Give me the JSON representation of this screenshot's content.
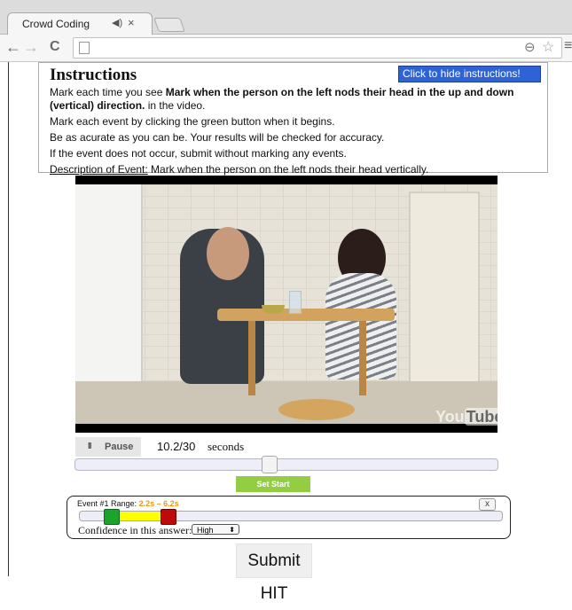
{
  "browser": {
    "tab_title": "Crowd Coding",
    "tab_audio_icon": "speaker-icon",
    "tab_close_icon": "close-icon",
    "back_icon": "←",
    "forward_icon": "→",
    "reload_icon": "C",
    "zoom_icon": "⊖",
    "star_icon": "☆",
    "menu_icon": "≡"
  },
  "instructions": {
    "title": "Instructions",
    "hide_button": "Click to hide instructions!",
    "line1_prefix": "Mark each time you see ",
    "line1_bold": "Mark when the person on the left nods their head in the up and down (vertical) direction.",
    "line1_suffix": " in the video.",
    "line2": "Mark each event by clicking the green button when it begins.",
    "line3": "Be as acurate as you can be. Your results will be checked for accuracy.",
    "line4": "If the event does not occur, submit without marking any events.",
    "desc_label": "Description of Event:",
    "desc_text": " Mark when the person on the left nods their head vertically."
  },
  "video": {
    "logo_you": "You",
    "logo_tube": "Tube"
  },
  "controls": {
    "pause_icon": "II",
    "pause_label": "Pause",
    "time": "10.2/30",
    "seconds_label": "seconds",
    "progress_fraction": 0.34,
    "set_start_label": "Set Start"
  },
  "event": {
    "label_prefix": "Event #1 Range: ",
    "range": "2.2s – 6.2s",
    "close": "x",
    "confidence_label": "Confidence in this answer:",
    "confidence_value": "High",
    "confidence_arrows": "⬍"
  },
  "submit_label": "Submit HIT",
  "colors": {
    "hide_button_bg": "#2e63d6",
    "set_start_bg": "#93cd42",
    "range_text": "#e89a1a",
    "range_fill": "#ffff00",
    "start_marker": "#1ca32c",
    "end_marker": "#bf0a0a"
  }
}
